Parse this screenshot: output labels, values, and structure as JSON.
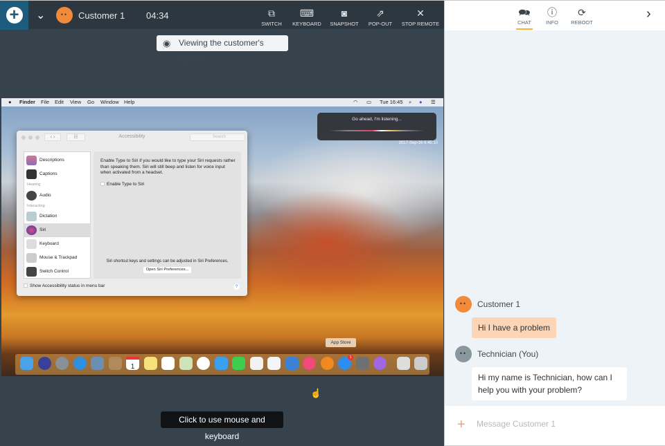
{
  "session": {
    "customer_name": "Customer 1",
    "timer": "04:34",
    "viewing_banner": "Viewing the customer's screen",
    "hint": "Click to use mouse and keyboard",
    "tools": [
      {
        "label": "SWITCH",
        "icon": "switch-monitor-icon"
      },
      {
        "label": "KEYBOARD",
        "icon": "keyboard-icon"
      },
      {
        "label": "SNAPSHOT",
        "icon": "camera-icon"
      },
      {
        "label": "POP-OUT",
        "icon": "pop-out-icon"
      },
      {
        "label": "STOP REMOTE",
        "icon": "close-icon"
      }
    ]
  },
  "remote": {
    "menubar": {
      "items": [
        "Finder",
        "File",
        "Edit",
        "View",
        "Go",
        "Window",
        "Help"
      ],
      "clock": "Tue 16:45"
    },
    "siri": {
      "text": "Go ahead, I'm listening...",
      "timestamp": "2017-Sep-16 6:45:10"
    },
    "prefs": {
      "title": "Accessibility",
      "search_placeholder": "Search",
      "sidebar": [
        {
          "label": "Descriptions"
        },
        {
          "label": "Captions"
        },
        {
          "header": "Hearing"
        },
        {
          "label": "Audio"
        },
        {
          "header": "Interacting"
        },
        {
          "label": "Dictation"
        },
        {
          "label": "Siri",
          "selected": true
        },
        {
          "label": "Keyboard"
        },
        {
          "label": "Mouse & Trackpad"
        },
        {
          "label": "Switch Control"
        }
      ],
      "description": "Enable Type to Siri if you would like to type your Siri requests rather than speaking them. Siri will still beep and listen for voice input when activated from a headset.",
      "checkbox": "Enable Type to Siri",
      "footer_note": "Siri shortcut keys and settings can be adjusted in Siri Preferences.",
      "open_button": "Open Siri Preferences...",
      "status_checkbox": "Show Accessibility status in menu bar",
      "help": "?"
    },
    "dock_tooltip": "App Store",
    "dock_badge": "1",
    "dock": [
      "Finder",
      "Siri",
      "Launchpad",
      "Safari",
      "Preview",
      "Contacts",
      "Calendar",
      "Notes",
      "Reminders",
      "Maps",
      "Photos",
      "Messages",
      "FaceTime",
      "Pages",
      "Numbers",
      "Keynote",
      "iTunes",
      "iBooks",
      "App Store",
      "System Preferences",
      "Feedback Assistant",
      "Downloads",
      "Trash"
    ],
    "calendar_day": "1"
  },
  "panel": {
    "tabs": [
      {
        "label": "CHAT",
        "icon": "chat-icon",
        "active": true
      },
      {
        "label": "INFO",
        "icon": "info-icon"
      },
      {
        "label": "REBOOT",
        "icon": "reboot-icon"
      }
    ],
    "messages": [
      {
        "sender": "Customer 1",
        "text": "Hi I have a problem"
      },
      {
        "sender": "Technician (You)",
        "text": "Hi my name is Technician, how can I help you with your problem?"
      }
    ],
    "composer_placeholder": "Message Customer 1"
  },
  "colors": {
    "accent": "#f5b82e",
    "customer_avatar": "#f28a3c",
    "brand_blue": "#1d5c7d",
    "customer_bubble": "#fbd5b5"
  }
}
